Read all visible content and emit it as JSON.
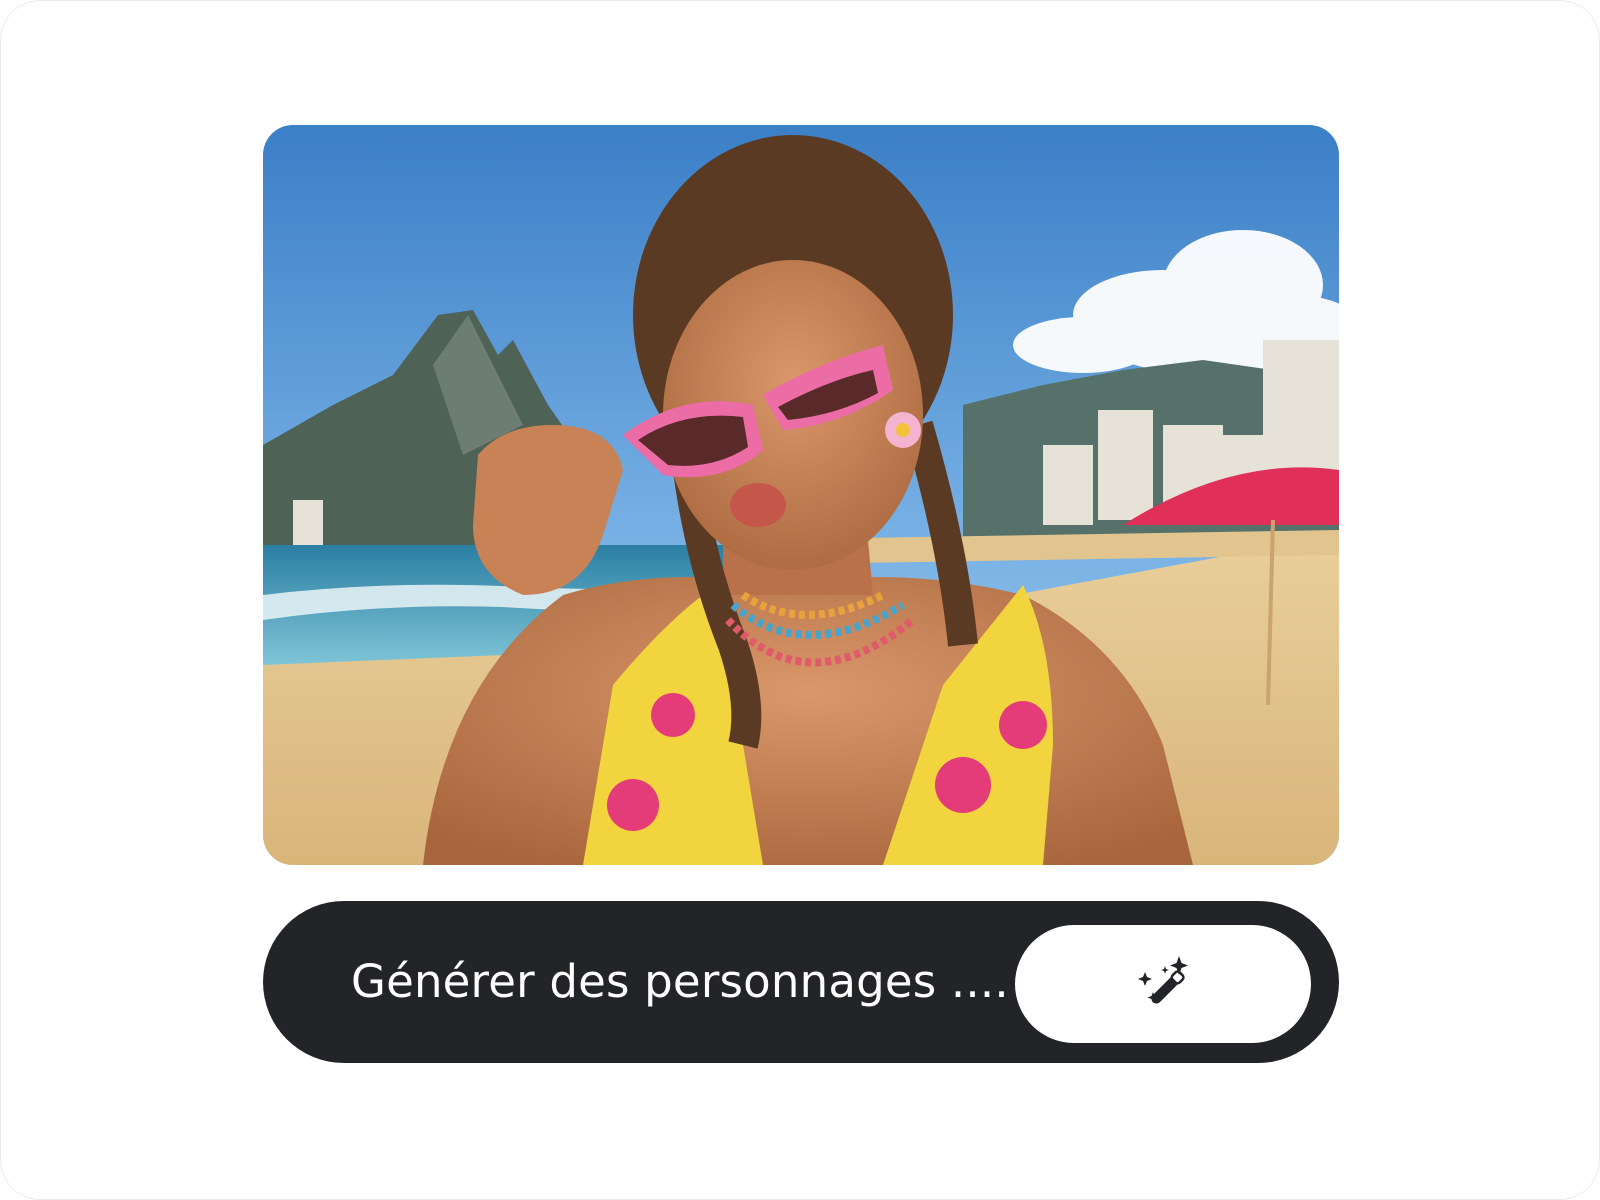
{
  "prompt_bar": {
    "text": "Générer des personnages ....",
    "button_icon": "magic-wand-sparkles-icon"
  },
  "image": {
    "subject": "beach-portrait-photo"
  },
  "colors": {
    "bar_background": "#232428",
    "bar_text": "#ffffff",
    "button_background": "#ffffff",
    "icon": "#232428"
  }
}
